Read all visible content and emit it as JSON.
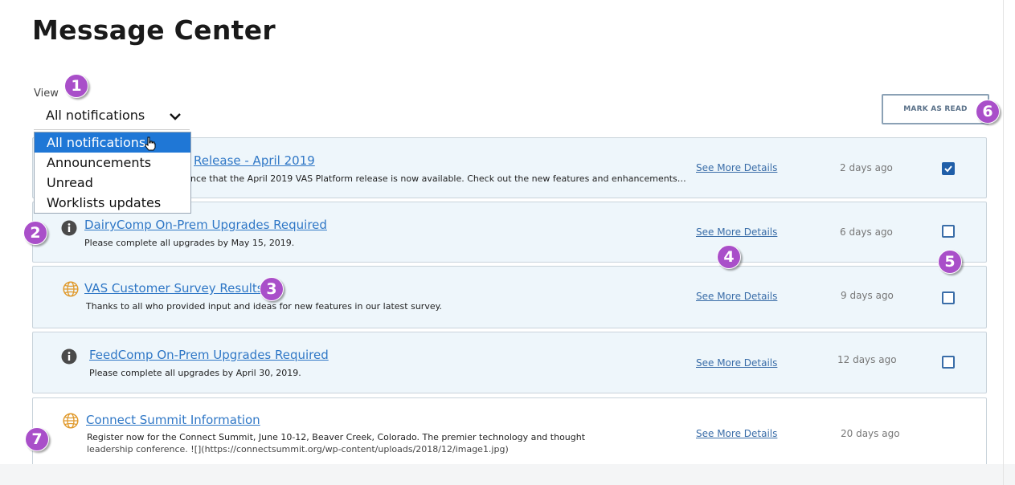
{
  "page": {
    "title": "Message Center"
  },
  "view": {
    "label": "View",
    "selected": "All notifications",
    "options": [
      "All notifications",
      "Announcements",
      "Unread",
      "Worklists updates"
    ]
  },
  "mark_as_read_label": "MARK AS READ",
  "see_more_label": "See More Details",
  "messages": [
    {
      "title": "Release - April 2019",
      "description": "nce that the April 2019 VAS Platform release is now available. Check out the new features and enhancements…",
      "time": "2 days ago",
      "checked": true,
      "icon": "info-icon"
    },
    {
      "title": "DairyComp On-Prem Upgrades Required",
      "description": "Please complete all upgrades by May 15, 2019.",
      "time": "6 days ago",
      "checked": false,
      "icon": "info-icon"
    },
    {
      "title": "VAS Customer Survey Results",
      "description": "Thanks to all who provided input and ideas for new features in our latest survey.",
      "time": "9 days ago",
      "checked": false,
      "icon": "globe-icon"
    },
    {
      "title": "FeedComp On-Prem Upgrades Required",
      "description": "Please complete all upgrades by April 30, 2019.",
      "time": "12 days ago",
      "checked": false,
      "icon": "info-icon"
    },
    {
      "title": "Connect Summit Information",
      "description": "Register now for the Connect Summit, June 10-12, Beaver Creek, Colorado. The premier technology and thought",
      "description_line2": "leadership conference.   ![](https://connectsummit.org/wp-content/uploads/2018/12/image1.jpg)",
      "time": "20 days ago",
      "icon": "globe-icon"
    }
  ],
  "callouts": [
    "1",
    "2",
    "3",
    "4",
    "5",
    "6",
    "7"
  ],
  "colors": {
    "accent": "#2f77c6",
    "unread_bg": "#eef6fb",
    "callout": "#a94fc9",
    "selected_option": "#1f77d6"
  }
}
